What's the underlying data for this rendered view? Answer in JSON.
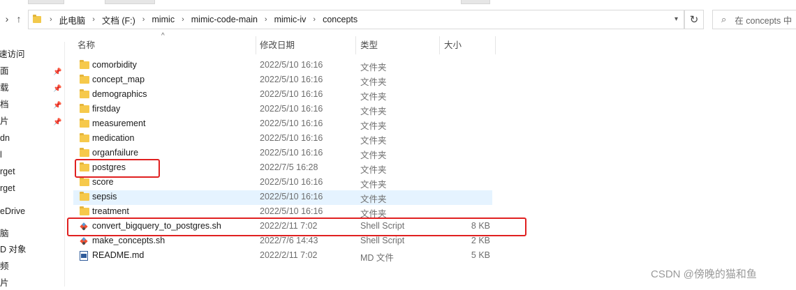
{
  "nav": {
    "breadcrumb": [
      "此电脑",
      "文档 (F:)",
      "mimic",
      "mimic-code-main",
      "mimic-iv",
      "concepts"
    ],
    "search_placeholder": "在 concepts 中"
  },
  "sidebar": {
    "items": [
      "速访问",
      "面",
      "载",
      "档",
      "片",
      "dn",
      "l",
      "rget",
      "rget",
      "eDrive",
      "脑",
      "D 对象",
      "频",
      "片"
    ]
  },
  "columns": {
    "name": "名称",
    "date": "修改日期",
    "type": "类型",
    "size": "大小"
  },
  "files": [
    {
      "name": "comorbidity",
      "date": "2022/5/10 16:16",
      "type": "文件夹",
      "size": "",
      "icon": "folder-icon"
    },
    {
      "name": "concept_map",
      "date": "2022/5/10 16:16",
      "type": "文件夹",
      "size": "",
      "icon": "folder-icon"
    },
    {
      "name": "demographics",
      "date": "2022/5/10 16:16",
      "type": "文件夹",
      "size": "",
      "icon": "folder-icon"
    },
    {
      "name": "firstday",
      "date": "2022/5/10 16:16",
      "type": "文件夹",
      "size": "",
      "icon": "folder-icon"
    },
    {
      "name": "measurement",
      "date": "2022/5/10 16:16",
      "type": "文件夹",
      "size": "",
      "icon": "folder-icon"
    },
    {
      "name": "medication",
      "date": "2022/5/10 16:16",
      "type": "文件夹",
      "size": "",
      "icon": "folder-icon"
    },
    {
      "name": "organfailure",
      "date": "2022/5/10 16:16",
      "type": "文件夹",
      "size": "",
      "icon": "folder-icon"
    },
    {
      "name": "postgres",
      "date": "2022/7/5 16:28",
      "type": "文件夹",
      "size": "",
      "icon": "folder-icon"
    },
    {
      "name": "score",
      "date": "2022/5/10 16:16",
      "type": "文件夹",
      "size": "",
      "icon": "folder-icon"
    },
    {
      "name": "sepsis",
      "date": "2022/5/10 16:16",
      "type": "文件夹",
      "size": "",
      "icon": "folder-icon"
    },
    {
      "name": "treatment",
      "date": "2022/5/10 16:16",
      "type": "文件夹",
      "size": "",
      "icon": "folder-icon"
    },
    {
      "name": "convert_bigquery_to_postgres.sh",
      "date": "2022/2/11 7:02",
      "type": "Shell Script",
      "size": "8 KB",
      "icon": "shell-script-icon"
    },
    {
      "name": "make_concepts.sh",
      "date": "2022/7/6 14:43",
      "type": "Shell Script",
      "size": "2 KB",
      "icon": "shell-script-icon"
    },
    {
      "name": "README.md",
      "date": "2022/2/11 7:02",
      "type": "MD 文件",
      "size": "5 KB",
      "icon": "markdown-file-icon"
    }
  ],
  "selected_row": "sepsis",
  "highlight_color": "#e02020",
  "watermark": "CSDN @傍晚的猫和鱼"
}
